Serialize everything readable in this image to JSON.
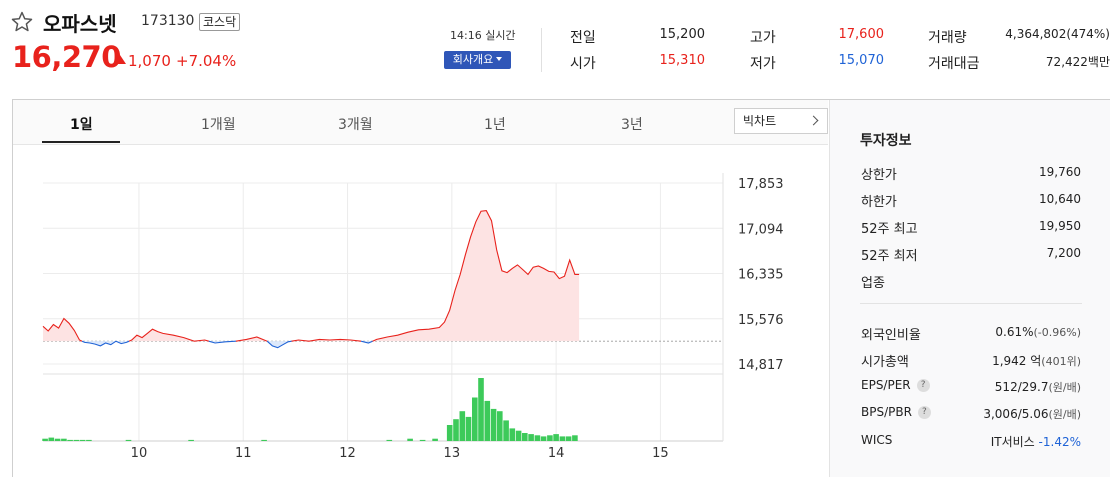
{
  "stock": {
    "name": "오파스넷",
    "code": "173130",
    "market": "코스닥",
    "price": "16,270",
    "change": "1,070",
    "change_pct": "+7.04%",
    "realtime": "14:16 실시간",
    "company_btn": "회사개요"
  },
  "summary": [
    {
      "label": "전일",
      "value": "15,200",
      "color": "black"
    },
    {
      "label": "고가",
      "value": "17,600",
      "color": "red"
    },
    {
      "label": "거래량",
      "value": "4,364,802(474%)",
      "color": "black"
    },
    {
      "label": "시가",
      "value": "15,310",
      "color": "red"
    },
    {
      "label": "저가",
      "value": "15,070",
      "color": "blue"
    },
    {
      "label": "거래대금",
      "value": "72,422백만",
      "color": "black"
    }
  ],
  "tabs": [
    "1일",
    "1개월",
    "3개월",
    "1년",
    "3년"
  ],
  "big_chart_btn": "빅차트",
  "invest": {
    "title": "투자정보",
    "items": [
      {
        "label": "상한가",
        "value": "19,760",
        "color": "red"
      },
      {
        "label": "하한가",
        "value": "10,640",
        "color": "blue"
      },
      {
        "label": "52주 최고",
        "value": "19,950",
        "color": "black"
      },
      {
        "label": "52주 최저",
        "value": "7,200",
        "color": "black"
      },
      {
        "label": "업종",
        "value": "",
        "color": "black"
      }
    ],
    "items2": [
      {
        "label": "외국인비율",
        "value": "0.61%",
        "extra": "(-0.96%)"
      },
      {
        "label": "시가총액",
        "value": "1,942 억",
        "extra": "(401위)"
      },
      {
        "label": "EPS/PER",
        "value": "512/29.7",
        "extra": "(원/배)",
        "q": "?"
      },
      {
        "label": "BPS/PBR",
        "value": "3,006/5.06",
        "extra": "(원/배)",
        "q": "?"
      },
      {
        "label": "WICS",
        "value": "IT서비스",
        "extra": "-1.42%",
        "extra_color": "blue"
      }
    ]
  },
  "colors": {
    "up": "#e8221c",
    "down": "#1f63d6",
    "vol": "#3dca5a"
  },
  "chart_data": {
    "type": "line",
    "prev_close": 15200,
    "y_ticks": [
      "17,853",
      "17,094",
      "16,335",
      "15,576",
      "14,817"
    ],
    "y_tick_values": [
      17853,
      17094,
      16335,
      15576,
      14817
    ],
    "x_ticks": [
      "10",
      "11",
      "12",
      "13",
      "14",
      "15"
    ],
    "x_tick_values": [
      10,
      11,
      12,
      13,
      14,
      15
    ],
    "x_range": [
      9.08,
      15.6
    ],
    "y_range": [
      14817,
      17853
    ],
    "price": [
      [
        9.08,
        15450
      ],
      [
        9.13,
        15370
      ],
      [
        9.18,
        15480
      ],
      [
        9.23,
        15420
      ],
      [
        9.28,
        15580
      ],
      [
        9.33,
        15500
      ],
      [
        9.38,
        15380
      ],
      [
        9.43,
        15220
      ],
      [
        9.48,
        15180
      ],
      [
        9.53,
        15170
      ],
      [
        9.58,
        15150
      ],
      [
        9.63,
        15120
      ],
      [
        9.68,
        15170
      ],
      [
        9.73,
        15140
      ],
      [
        9.78,
        15200
      ],
      [
        9.83,
        15160
      ],
      [
        9.88,
        15180
      ],
      [
        9.93,
        15220
      ],
      [
        9.98,
        15300
      ],
      [
        10.03,
        15260
      ],
      [
        10.08,
        15330
      ],
      [
        10.13,
        15400
      ],
      [
        10.18,
        15360
      ],
      [
        10.23,
        15330
      ],
      [
        10.33,
        15300
      ],
      [
        10.43,
        15260
      ],
      [
        10.53,
        15200
      ],
      [
        10.63,
        15220
      ],
      [
        10.73,
        15170
      ],
      [
        10.83,
        15190
      ],
      [
        10.93,
        15200
      ],
      [
        11.03,
        15230
      ],
      [
        11.13,
        15270
      ],
      [
        11.23,
        15200
      ],
      [
        11.28,
        15120
      ],
      [
        11.33,
        15090
      ],
      [
        11.38,
        15140
      ],
      [
        11.43,
        15190
      ],
      [
        11.53,
        15220
      ],
      [
        11.63,
        15200
      ],
      [
        11.73,
        15230
      ],
      [
        11.83,
        15220
      ],
      [
        11.93,
        15230
      ],
      [
        12.03,
        15220
      ],
      [
        12.13,
        15200
      ],
      [
        12.2,
        15170
      ],
      [
        12.28,
        15230
      ],
      [
        12.38,
        15270
      ],
      [
        12.48,
        15300
      ],
      [
        12.58,
        15350
      ],
      [
        12.68,
        15390
      ],
      [
        12.78,
        15400
      ],
      [
        12.88,
        15430
      ],
      [
        12.93,
        15520
      ],
      [
        12.98,
        15720
      ],
      [
        13.03,
        16050
      ],
      [
        13.08,
        16320
      ],
      [
        13.13,
        16650
      ],
      [
        13.18,
        16950
      ],
      [
        13.23,
        17200
      ],
      [
        13.28,
        17380
      ],
      [
        13.33,
        17390
      ],
      [
        13.38,
        17220
      ],
      [
        13.43,
        16730
      ],
      [
        13.48,
        16380
      ],
      [
        13.53,
        16350
      ],
      [
        13.58,
        16420
      ],
      [
        13.63,
        16480
      ],
      [
        13.68,
        16400
      ],
      [
        13.73,
        16320
      ],
      [
        13.78,
        16440
      ],
      [
        13.83,
        16460
      ],
      [
        13.88,
        16420
      ],
      [
        13.93,
        16370
      ],
      [
        13.98,
        16360
      ],
      [
        14.03,
        16250
      ],
      [
        14.08,
        16290
      ],
      [
        14.13,
        16560
      ],
      [
        14.18,
        16320
      ],
      [
        14.22,
        16320
      ]
    ],
    "volume": [
      [
        9.1,
        2
      ],
      [
        9.16,
        3
      ],
      [
        9.22,
        2
      ],
      [
        9.28,
        2
      ],
      [
        9.34,
        1
      ],
      [
        9.4,
        1
      ],
      [
        9.46,
        1
      ],
      [
        9.52,
        1
      ],
      [
        9.9,
        1
      ],
      [
        10.5,
        1
      ],
      [
        11.2,
        1
      ],
      [
        12.4,
        1
      ],
      [
        12.6,
        2
      ],
      [
        12.72,
        1
      ],
      [
        12.84,
        2
      ],
      [
        12.98,
        14
      ],
      [
        13.04,
        19
      ],
      [
        13.1,
        26
      ],
      [
        13.16,
        21
      ],
      [
        13.22,
        38
      ],
      [
        13.28,
        55
      ],
      [
        13.34,
        35
      ],
      [
        13.4,
        28
      ],
      [
        13.46,
        26
      ],
      [
        13.52,
        18
      ],
      [
        13.58,
        11
      ],
      [
        13.64,
        9
      ],
      [
        13.7,
        7
      ],
      [
        13.76,
        6
      ],
      [
        13.82,
        5
      ],
      [
        13.88,
        4
      ],
      [
        13.94,
        5
      ],
      [
        14.0,
        6
      ],
      [
        14.06,
        4
      ],
      [
        14.12,
        4
      ],
      [
        14.18,
        5
      ]
    ]
  }
}
